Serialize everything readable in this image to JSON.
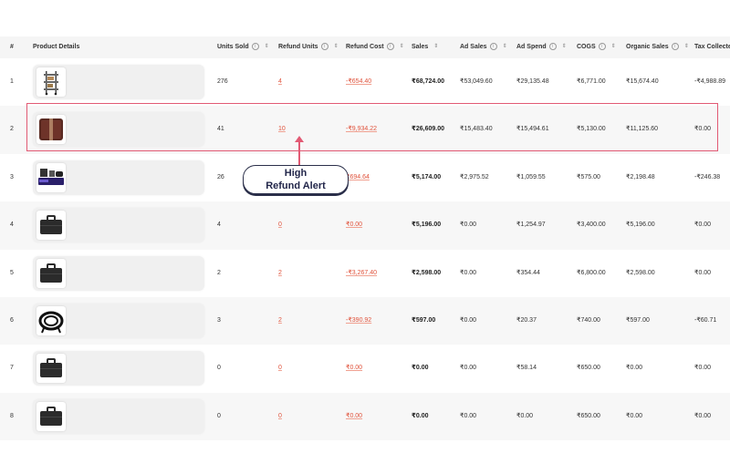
{
  "headers": {
    "num": "#",
    "product_details": "Product Details",
    "units_sold": "Units Sold",
    "refund_units": "Refund Units",
    "refund_cost": "Refund Cost",
    "sales": "Sales",
    "ad_sales": "Ad Sales",
    "ad_spend": "Ad Spend",
    "cogs": "COGS",
    "organic_sales": "Organic Sales",
    "tax_collected": "Tax Collected"
  },
  "rows": [
    {
      "num": "1",
      "units_sold": "276",
      "refund_units": "4",
      "refund_cost": "-₹654.40",
      "sales": "₹68,724.00",
      "ad_sales": "₹53,049.60",
      "ad_spend": "₹29,135.48",
      "cogs": "₹6,771.00",
      "organic_sales": "₹15,674.40",
      "tax_collected": "-₹4,988.89",
      "product_icon": "shelf-rack-icon"
    },
    {
      "num": "2",
      "units_sold": "41",
      "refund_units": "10",
      "refund_cost": "-₹9,934.22",
      "sales": "₹26,609.00",
      "ad_sales": "₹15,483.40",
      "ad_spend": "₹15,494.61",
      "cogs": "₹5,130.00",
      "organic_sales": "₹11,125.60",
      "tax_collected": "₹0.00",
      "product_icon": "cushion-icon"
    },
    {
      "num": "3",
      "units_sold": "26",
      "refund_units": "",
      "refund_cost": "₹694.64",
      "sales": "₹5,174.00",
      "ad_sales": "₹2,975.52",
      "ad_spend": "₹1,059.55",
      "cogs": "₹575.00",
      "organic_sales": "₹2,198.48",
      "tax_collected": "-₹246.38",
      "product_icon": "gaming-set-icon"
    },
    {
      "num": "4",
      "units_sold": "4",
      "refund_units": "0",
      "refund_cost": "₹0.00",
      "sales": "₹5,196.00",
      "ad_sales": "₹0.00",
      "ad_spend": "₹1,254.97",
      "cogs": "₹3,400.00",
      "organic_sales": "₹5,196.00",
      "tax_collected": "₹0.00",
      "product_icon": "briefcase-icon"
    },
    {
      "num": "5",
      "units_sold": "2",
      "refund_units": "2",
      "refund_cost": "-₹3,267.40",
      "sales": "₹2,598.00",
      "ad_sales": "₹0.00",
      "ad_spend": "₹354.44",
      "cogs": "₹6,800.00",
      "organic_sales": "₹2,598.00",
      "tax_collected": "₹0.00",
      "product_icon": "briefcase-icon"
    },
    {
      "num": "6",
      "units_sold": "3",
      "refund_units": "2",
      "refund_cost": "-₹390.92",
      "sales": "₹597.00",
      "ad_sales": "₹0.00",
      "ad_spend": "₹20.37",
      "cogs": "₹740.00",
      "organic_sales": "₹597.00",
      "tax_collected": "-₹60.71",
      "product_icon": "cable-icon"
    },
    {
      "num": "7",
      "units_sold": "0",
      "refund_units": "0",
      "refund_cost": "₹0.00",
      "sales": "₹0.00",
      "ad_sales": "₹0.00",
      "ad_spend": "₹58.14",
      "cogs": "₹650.00",
      "organic_sales": "₹0.00",
      "tax_collected": "₹0.00",
      "product_icon": "briefcase-icon"
    },
    {
      "num": "8",
      "units_sold": "0",
      "refund_units": "0",
      "refund_cost": "₹0.00",
      "sales": "₹0.00",
      "ad_sales": "₹0.00",
      "ad_spend": "₹0.00",
      "cogs": "₹650.00",
      "organic_sales": "₹0.00",
      "tax_collected": "₹0.00",
      "product_icon": "briefcase-icon"
    }
  ],
  "callout": {
    "line1": "High",
    "line2": "Refund Alert"
  },
  "colors": {
    "highlight": "#e25a74",
    "refund": "#e0533c",
    "callout_border": "#2b2f4a"
  }
}
